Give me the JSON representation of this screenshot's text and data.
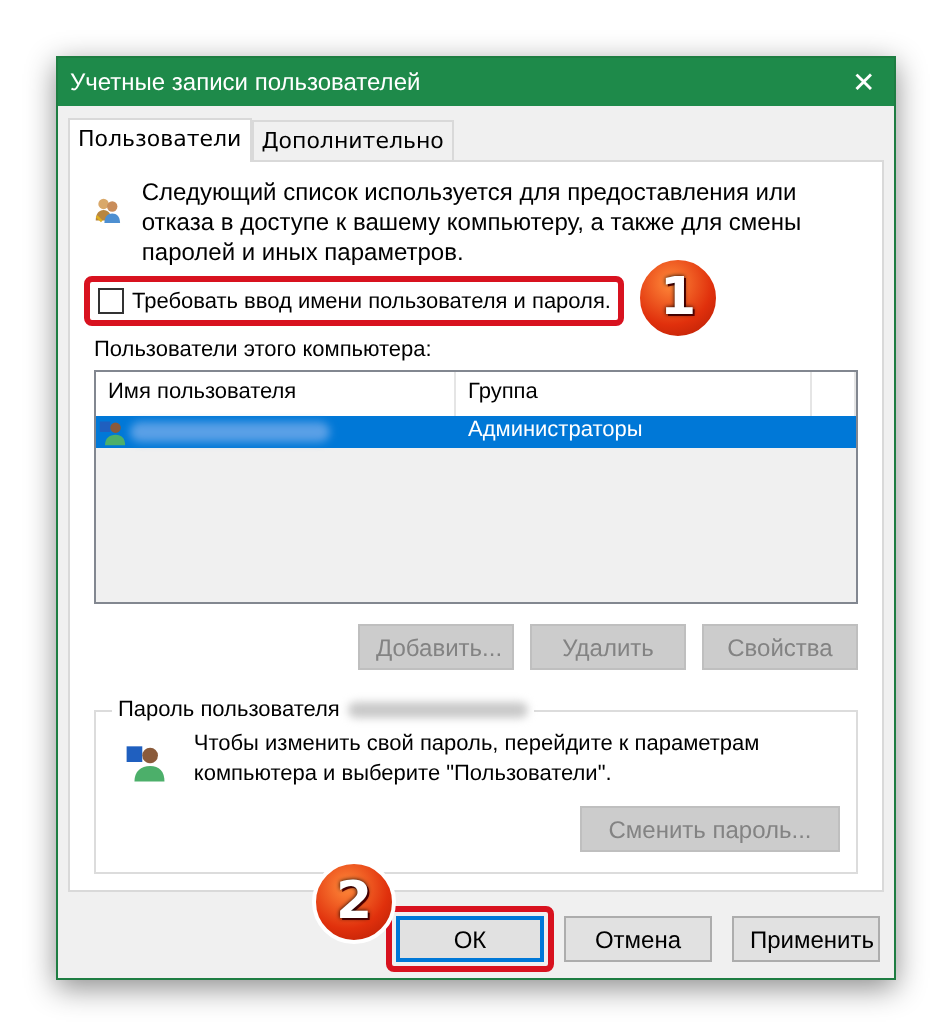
{
  "window": {
    "title": "Учетные записи пользователей",
    "close": "✕"
  },
  "tabs": [
    {
      "label": "Пользователи",
      "selected": true
    },
    {
      "label": "Дополнительно",
      "selected": false
    }
  ],
  "intro": "Следующий список используется для предоставления или отказа в доступе к вашему компьютеру, а также для смены паролей и иных параметров.",
  "require_password": {
    "label": "Требовать ввод имени пользователя и пароля.",
    "checked": false,
    "highlighted": true
  },
  "users_label": "Пользователи этого компьютера:",
  "table": {
    "columns": [
      "Имя пользователя",
      "Группа"
    ],
    "rows": [
      {
        "group": "Администраторы",
        "selected": true
      }
    ]
  },
  "list_buttons": [
    {
      "label": "Добавить...",
      "disabled": true
    },
    {
      "label": "Удалить",
      "disabled": true
    },
    {
      "label": "Свойства",
      "disabled": true
    }
  ],
  "password_group": {
    "title": "Пароль пользователя",
    "text": "Чтобы изменить свой пароль, перейдите к параметрам компьютера и выберите \"Пользователи\".",
    "button": {
      "label": "Сменить пароль...",
      "disabled": true
    }
  },
  "dialog_buttons": [
    {
      "label": "ОК",
      "default": true,
      "highlighted": true
    },
    {
      "label": "Отмена",
      "default": false,
      "highlighted": false
    },
    {
      "label": "Применить",
      "default": false,
      "highlighted": false
    }
  ],
  "annotations": [
    {
      "number": "1"
    },
    {
      "number": "2"
    }
  ]
}
